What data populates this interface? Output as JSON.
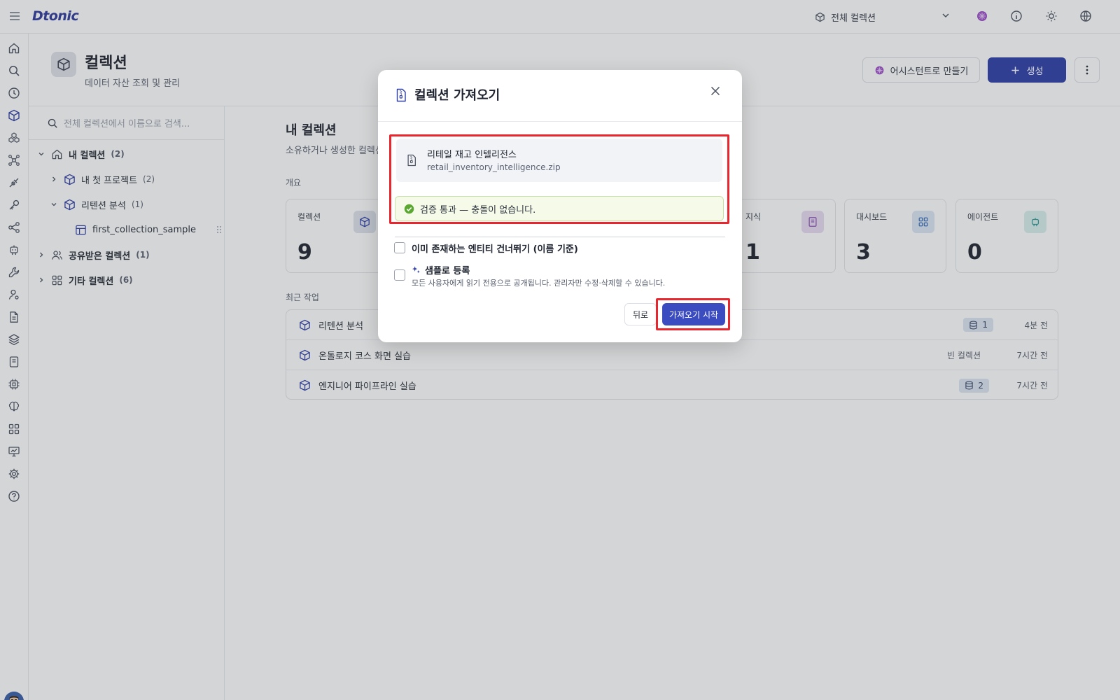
{
  "app": {
    "logo": "Dtonic"
  },
  "topbar": {
    "collection_scope": "전체 컬렉션"
  },
  "header": {
    "title": "컬렉션",
    "subtitle": "데이터 자산 조회 및 관리",
    "assistant_button": "어시스턴트로 만들기",
    "create_button": "생성"
  },
  "tree": {
    "search_placeholder": "전체 컬렉션에서 이름으로 검색...",
    "items": [
      {
        "label": "내 컬렉션",
        "count": "(2)"
      },
      {
        "label": "내 첫 프로젝트",
        "count": "(2)"
      },
      {
        "label": "리텐션 분석",
        "count": "(1)"
      },
      {
        "label": "first_collection_sample",
        "count": ""
      },
      {
        "label": "공유받은 컬렉션",
        "count": "(1)"
      },
      {
        "label": "기타 컬렉션",
        "count": "(6)"
      }
    ]
  },
  "main": {
    "section_title": "내 컬렉션",
    "section_subtitle": "소유하거나 생성한 컬렉션",
    "overview_label": "개요",
    "stats": [
      {
        "label": "컬렉션",
        "value": "9",
        "icon": "cube-icon",
        "color": "#dde2ec"
      },
      {
        "label": "지식",
        "value": "1",
        "icon": "book-icon",
        "color": "#e9dcf3"
      },
      {
        "label": "대시보드",
        "value": "3",
        "icon": "grid-icon",
        "color": "#dbe7f5"
      },
      {
        "label": "에이전트",
        "value": "0",
        "icon": "bot-icon",
        "color": "#d9f0ef"
      }
    ],
    "recent_label": "최근 작업",
    "recent": [
      {
        "name": "리텐션 분석",
        "badge": "1",
        "tag": "",
        "time": "4분 전"
      },
      {
        "name": "온톨로지 코스 화면 실습",
        "badge": "",
        "tag": "빈 컬렉션",
        "time": "7시간 전"
      },
      {
        "name": "엔지니어 파이프라인 실습",
        "badge": "2",
        "tag": "",
        "time": "7시간 전"
      }
    ]
  },
  "modal": {
    "title": "컬렉션 가져오기",
    "file_name": "리테일 재고 인텔리전스",
    "file_path": "retail_inventory_intelligence.zip",
    "validation": "검증 통과 — 충돌이 없습니다.",
    "option_skip": "이미 존재하는 엔티티 건너뛰기 (이름 기준)",
    "option_sample": "샘플로 등록",
    "option_sample_desc": "모든 사용자에게 읽기 전용으로 공개됩니다. 관리자만 수정·삭제할 수 있습니다.",
    "back_button": "뒤로",
    "start_button": "가져오기 시작"
  },
  "colors": {
    "accent": "#2f3fa8",
    "highlight": "#e8262d",
    "success": "#5aa832"
  }
}
